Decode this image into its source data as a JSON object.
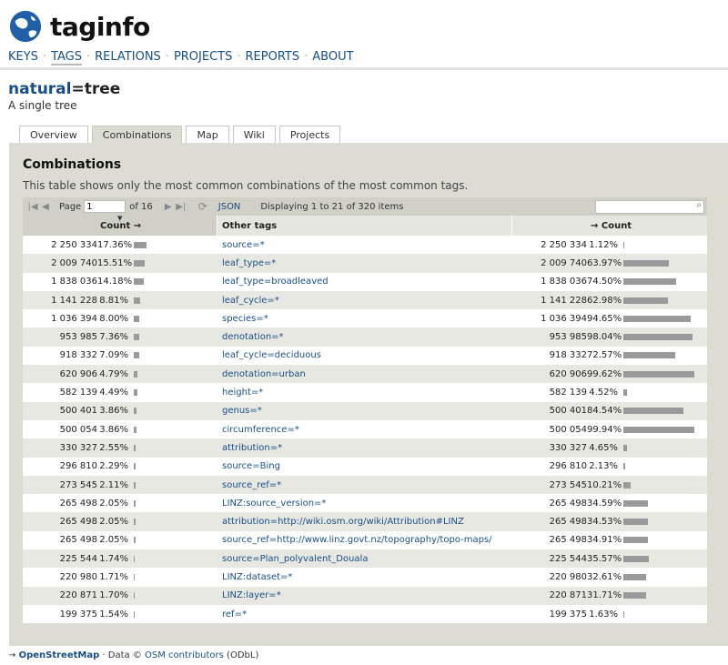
{
  "brand": {
    "name": "taginfo",
    "logo_icon": "globe-icon"
  },
  "nav": [
    {
      "label": "KEYS",
      "active": false
    },
    {
      "label": "TAGS",
      "active": true
    },
    {
      "label": "RELATIONS",
      "active": false
    },
    {
      "label": "PROJECTS",
      "active": false
    },
    {
      "label": "REPORTS",
      "active": false
    },
    {
      "label": "ABOUT",
      "active": false
    }
  ],
  "page": {
    "key": "natural",
    "eq": "=",
    "value": "tree",
    "description": "A single tree"
  },
  "tabs": [
    {
      "label": "Overview",
      "active": false
    },
    {
      "label": "Combinations",
      "active": true
    },
    {
      "label": "Map",
      "active": false
    },
    {
      "label": "Wiki",
      "active": false
    },
    {
      "label": "Projects",
      "active": false
    }
  ],
  "section": {
    "title": "Combinations",
    "description": "This table shows only the most common combinations of the most common tags."
  },
  "pager": {
    "page_label": "Page",
    "page_value": "1",
    "of_label": "of 16",
    "json_label": "JSON",
    "display_text": "Displaying 1 to 21 of 320 items",
    "search_placeholder": ""
  },
  "columns": {
    "count_left": "Count →",
    "other_tags": "Other tags",
    "count_right": "→ Count"
  },
  "rows": [
    {
      "c1": "2 250 334",
      "p1": "17.36%",
      "f1": 17.36,
      "tag": "source=*",
      "c2": "2 250 334",
      "p2": "1.12%",
      "f2": 1.12
    },
    {
      "c1": "2 009 740",
      "p1": "15.51%",
      "f1": 15.51,
      "tag": "leaf_type=*",
      "c2": "2 009 740",
      "p2": "63.97%",
      "f2": 63.97
    },
    {
      "c1": "1 838 036",
      "p1": "14.18%",
      "f1": 14.18,
      "tag": "leaf_type=broadleaved",
      "c2": "1 838 036",
      "p2": "74.50%",
      "f2": 74.5
    },
    {
      "c1": "1 141 228",
      "p1": "8.81%",
      "f1": 8.81,
      "tag": "leaf_cycle=*",
      "c2": "1 141 228",
      "p2": "62.98%",
      "f2": 62.98
    },
    {
      "c1": "1 036 394",
      "p1": "8.00%",
      "f1": 8.0,
      "tag": "species=*",
      "c2": "1 036 394",
      "p2": "94.65%",
      "f2": 94.65
    },
    {
      "c1": "953 985",
      "p1": "7.36%",
      "f1": 7.36,
      "tag": "denotation=*",
      "c2": "953 985",
      "p2": "98.04%",
      "f2": 98.04
    },
    {
      "c1": "918 332",
      "p1": "7.09%",
      "f1": 7.09,
      "tag": "leaf_cycle=deciduous",
      "c2": "918 332",
      "p2": "72.57%",
      "f2": 72.57
    },
    {
      "c1": "620 906",
      "p1": "4.79%",
      "f1": 4.79,
      "tag": "denotation=urban",
      "c2": "620 906",
      "p2": "99.62%",
      "f2": 99.62
    },
    {
      "c1": "582 139",
      "p1": "4.49%",
      "f1": 4.49,
      "tag": "height=*",
      "c2": "582 139",
      "p2": "4.52%",
      "f2": 4.52
    },
    {
      "c1": "500 401",
      "p1": "3.86%",
      "f1": 3.86,
      "tag": "genus=*",
      "c2": "500 401",
      "p2": "84.54%",
      "f2": 84.54
    },
    {
      "c1": "500 054",
      "p1": "3.86%",
      "f1": 3.86,
      "tag": "circumference=*",
      "c2": "500 054",
      "p2": "99.94%",
      "f2": 99.94
    },
    {
      "c1": "330 327",
      "p1": "2.55%",
      "f1": 2.55,
      "tag": "attribution=*",
      "c2": "330 327",
      "p2": "4.65%",
      "f2": 4.65
    },
    {
      "c1": "296 810",
      "p1": "2.29%",
      "f1": 2.29,
      "tag": "source=Bing",
      "c2": "296 810",
      "p2": "2.13%",
      "f2": 2.13
    },
    {
      "c1": "273 545",
      "p1": "2.11%",
      "f1": 2.11,
      "tag": "source_ref=*",
      "c2": "273 545",
      "p2": "10.21%",
      "f2": 10.21
    },
    {
      "c1": "265 498",
      "p1": "2.05%",
      "f1": 2.05,
      "tag": "LINZ:source_version=*",
      "c2": "265 498",
      "p2": "34.59%",
      "f2": 34.59
    },
    {
      "c1": "265 498",
      "p1": "2.05%",
      "f1": 2.05,
      "tag": "attribution=http://wiki.osm.org/wiki/Attribution#LINZ",
      "c2": "265 498",
      "p2": "34.53%",
      "f2": 34.53
    },
    {
      "c1": "265 498",
      "p1": "2.05%",
      "f1": 2.05,
      "tag": "source_ref=http://www.linz.govt.nz/topography/topo-maps/",
      "c2": "265 498",
      "p2": "34.91%",
      "f2": 34.91
    },
    {
      "c1": "225 544",
      "p1": "1.74%",
      "f1": 1.74,
      "tag": "source=Plan_polyvalent_Douala",
      "c2": "225 544",
      "p2": "35.57%",
      "f2": 35.57
    },
    {
      "c1": "220 980",
      "p1": "1.71%",
      "f1": 1.71,
      "tag": "LINZ:dataset=*",
      "c2": "220 980",
      "p2": "32.61%",
      "f2": 32.61
    },
    {
      "c1": "220 871",
      "p1": "1.70%",
      "f1": 1.7,
      "tag": "LINZ:layer=*",
      "c2": "220 871",
      "p2": "31.71%",
      "f2": 31.71
    },
    {
      "c1": "199 375",
      "p1": "1.54%",
      "f1": 1.54,
      "tag": "ref=*",
      "c2": "199 375",
      "p2": "1.63%",
      "f2": 1.63
    }
  ],
  "footer": {
    "arrow": "→ ",
    "osm": "OpenStreetMap",
    "sep": " · Data © ",
    "contrib": "OSM contributors",
    "license": " (ODbL)"
  }
}
